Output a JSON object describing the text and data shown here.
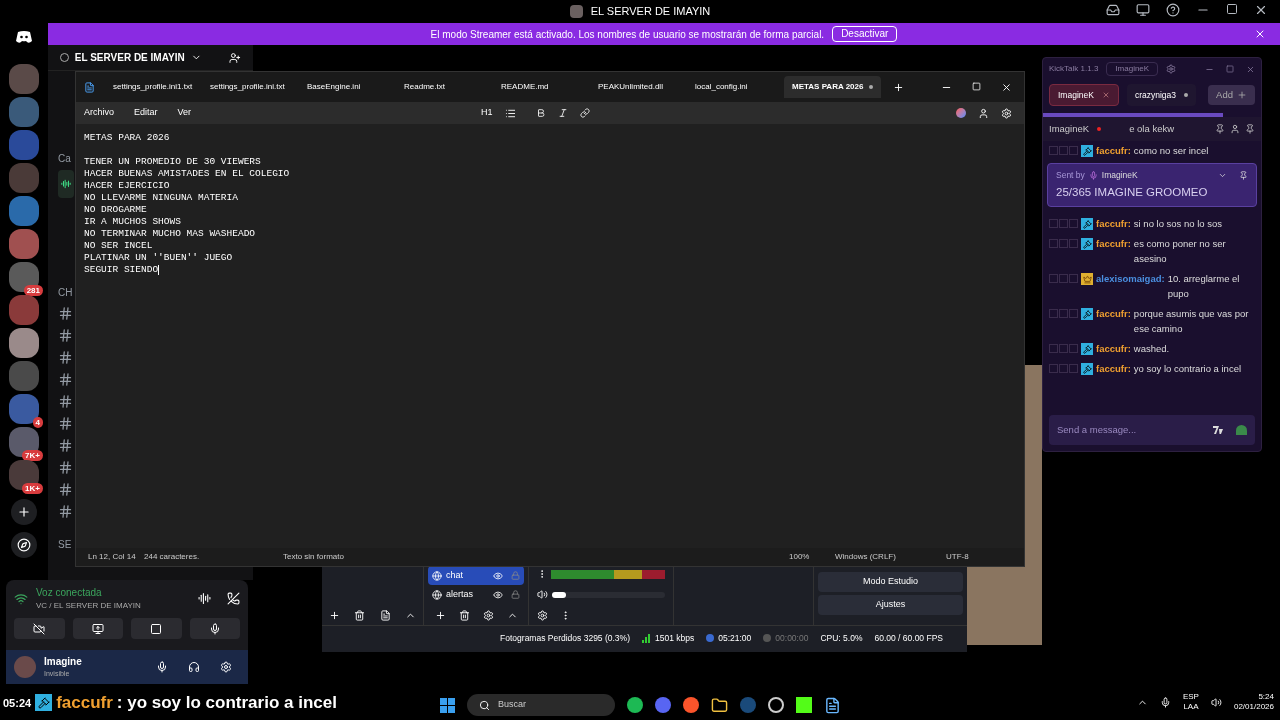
{
  "discord": {
    "title": "EL SERVER DE IMAYIN",
    "banner": {
      "text": "El modo Streamer está activado. Los nombres de usuario se mostrarán de forma parcial.",
      "button": "Desactivar"
    },
    "servers": [
      {
        "kind": "plain"
      },
      {
        "kind": "plain"
      },
      {
        "kind": "plain"
      },
      {
        "kind": "plain"
      },
      {
        "kind": "plain"
      },
      {
        "kind": "plain"
      },
      {
        "kind": "badged",
        "badge": "281"
      },
      {
        "kind": "plain"
      },
      {
        "kind": "plain"
      },
      {
        "kind": "plain"
      },
      {
        "kind": "badged",
        "badge": "4"
      },
      {
        "kind": "badged",
        "badge": "7K+"
      },
      {
        "kind": "badged",
        "badge": "1K+"
      }
    ],
    "server_name": "EL SERVER DE IMAYIN",
    "fragments": [
      {
        "text": "Ca"
      },
      {
        "text": "CH"
      },
      {
        "text": "SE"
      }
    ],
    "voice": {
      "status": "Voz conectada",
      "channel": "VC / EL SERVER DE IMAYIN"
    },
    "user": {
      "name": "Imagine",
      "status": "Invisible"
    }
  },
  "notepad": {
    "tabs": [
      {
        "label": "settings_profile.ini1.txt",
        "selected": false
      },
      {
        "label": "settings_profile.ini.txt",
        "selected": false
      },
      {
        "label": "BaseEngine.ini",
        "selected": false
      },
      {
        "label": "Readme.txt",
        "selected": false
      },
      {
        "label": "README.md",
        "selected": false
      },
      {
        "label": "PEAKUnlimited.dll",
        "selected": false
      },
      {
        "label": "local_config.ini",
        "selected": false
      },
      {
        "label": "METAS PARA 2026",
        "selected": true
      }
    ],
    "menu": [
      "Archivo",
      "Editar",
      "Ver"
    ],
    "heading": "H1",
    "title": "METAS PARA 2026",
    "lines": [
      "TENER UN PROMEDIO DE 30 VIEWERS",
      "HACER BUENAS AMISTADES EN EL COLEGIO",
      "HACER EJERCICIO",
      "NO LLEVARME NINGUNA MATERIA",
      "NO DROGARME",
      "IR A MUCHOS SHOWS",
      "NO TERMINAR MUCHO MAS WASHEADO",
      "NO SER INCEL",
      "PLATINAR UN ''BUEN'' JUEGO",
      "SEGUIR SIENDO"
    ],
    "status": {
      "position": "Ln 12, Col 14",
      "chars": "244 caracteres.",
      "format": "Texto sin formato",
      "zoom": "100%",
      "line_endings": "Windows (CRLF)",
      "encoding": "UTF-8"
    }
  },
  "obs": {
    "sources": [
      {
        "name": "chat",
        "selected": true
      },
      {
        "name": "alertas",
        "selected": false
      }
    ],
    "volume": {
      "level": 0.12
    },
    "buttons": [
      "Modo Estudio",
      "Ajustes"
    ],
    "stats": {
      "dropped": "Fotogramas Perdidos 3295 (0.3%)",
      "bitrate": "1501 kbps",
      "stream_time": "05:21:00",
      "record_time": "00:00:00",
      "cpu": "CPU: 5.0%",
      "fps": "60.00 / 60.00 FPS"
    }
  },
  "kicktalk": {
    "title": "KickTalk 1.1.3",
    "account": "ImagineK",
    "tabs": [
      {
        "label": "ImagineK",
        "selected": true
      },
      {
        "label": "crazyniga3",
        "selected": false
      }
    ],
    "add": "Add",
    "header": {
      "channel": "ImagineK",
      "title": "e ola kekw"
    },
    "pinned": {
      "label": "Sent by",
      "user": "ImagineK",
      "text": "25/365 IMAGINE GROOMEO"
    },
    "messages": [
      {
        "kind": "mod",
        "user": "faccufr:",
        "color": "#f0a030",
        "text": "como no ser incel"
      },
      {
        "kind": "mod",
        "user": "faccufr:",
        "color": "#f0a030",
        "text": "si no lo sos no lo sos"
      },
      {
        "kind": "mod",
        "user": "faccufr:",
        "color": "#f0a030",
        "text": "es como poner no ser asesino"
      },
      {
        "kind": "vip",
        "user": "alexisomaigad:",
        "color": "#4a8fe0",
        "text": "10. arreglarme el pupo"
      },
      {
        "kind": "mod",
        "user": "faccufr:",
        "color": "#f0a030",
        "text": "porque asumis que vas por ese camino"
      },
      {
        "kind": "mod",
        "user": "faccufr:",
        "color": "#f0a030",
        "text": "washed."
      },
      {
        "kind": "mod",
        "user": "faccufr:",
        "color": "#f0a030",
        "text": "yo soy lo contrario a incel"
      }
    ],
    "placeholder": "Send a message..."
  },
  "overlay": {
    "time": "05:24",
    "user": "faccufr",
    "text": ": yo soy lo contrario a incel"
  },
  "taskbar": {
    "search": "Buscar",
    "lang": "ESP",
    "layout": "LAA",
    "time": "5:24",
    "date": "02/01/2026"
  }
}
